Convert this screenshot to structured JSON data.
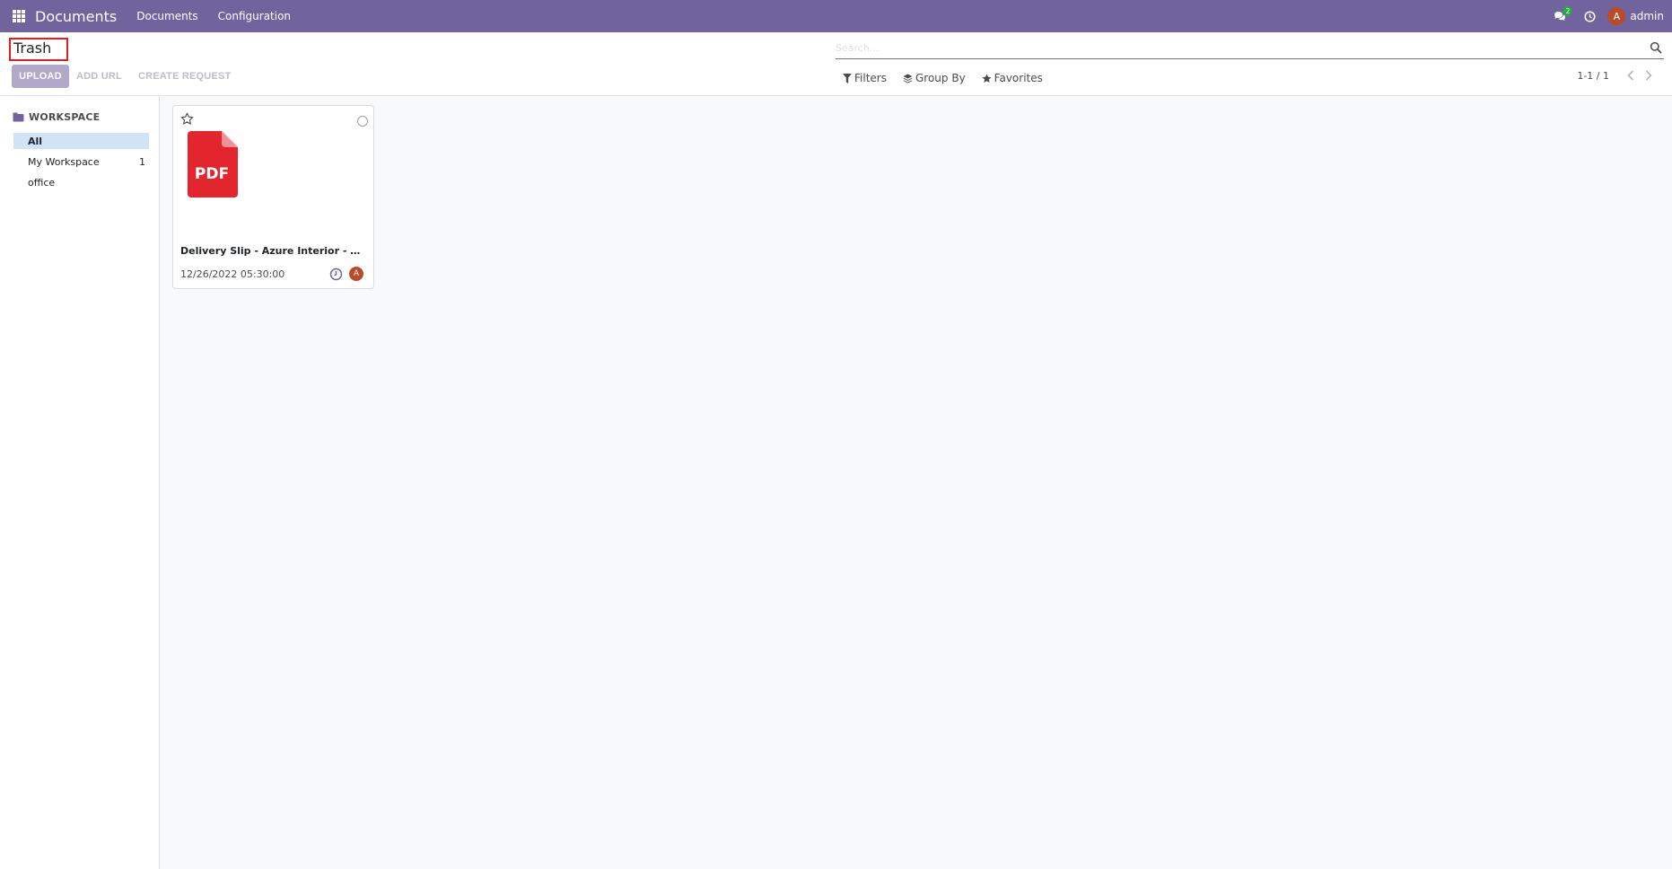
{
  "navbar": {
    "brand": "Documents",
    "menu": [
      "Documents",
      "Configuration"
    ],
    "chat_badge": "2",
    "user_initial": "A",
    "user_name": "admin",
    "bg_color": "#71639e"
  },
  "control_panel": {
    "title": "Trash",
    "buttons": {
      "upload": "UPLOAD",
      "add_url": "ADD URL",
      "create_request": "CREATE REQUEST"
    },
    "search": {
      "placeholder": "Search..."
    },
    "filters": {
      "filters": "Filters",
      "group_by": "Group By",
      "favorites": "Favorites"
    },
    "pager": {
      "value": "1-1 / 1"
    }
  },
  "sidebar": {
    "header": "WORKSPACE",
    "items": [
      {
        "label": "All",
        "count": "",
        "active": true
      },
      {
        "label": "My Workspace",
        "count": "1",
        "active": false
      },
      {
        "label": "office",
        "count": "",
        "active": false
      }
    ]
  },
  "documents": [
    {
      "name": "Delivery Slip - Azure Interior - WH_I...",
      "type_label": "PDF",
      "date": "12/26/2022 05:30:00",
      "owner_initial": "A",
      "thumb_color": "#e3262e"
    }
  ]
}
